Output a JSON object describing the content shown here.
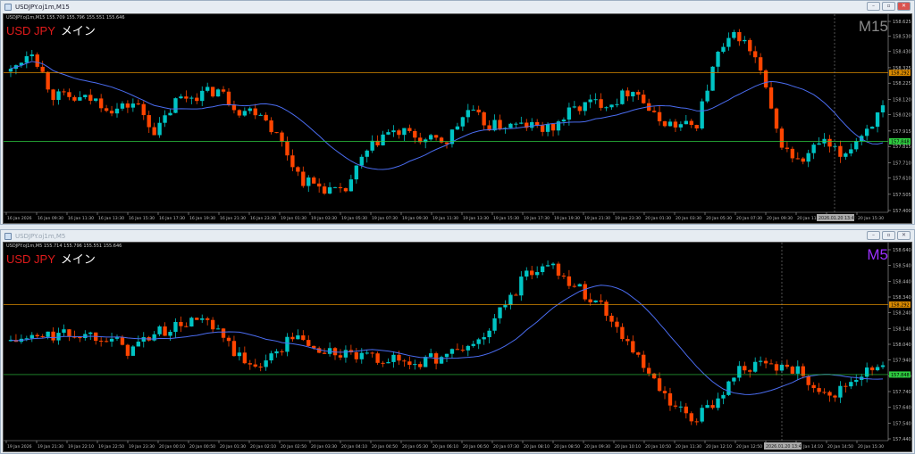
{
  "windows": [
    {
      "title": "USDJPY.oj1m,M15",
      "header": "USDJPY.oj1m,M15  155.709 155.796 155.551 155.646",
      "symbol": "USD JPY",
      "label_jp": "メイン",
      "timeframe": "M15",
      "timeframe_color": "#8a8a8a",
      "price_axis": [
        "158.625",
        "158.530",
        "158.430",
        "158.325",
        "158.225",
        "158.120",
        "158.020",
        "157.915",
        "157.815",
        "157.710",
        "157.610",
        "157.505",
        "157.400"
      ],
      "axis_min": 157.4,
      "axis_max": 158.625,
      "hline_orange": {
        "label": "158.292",
        "value": 158.292
      },
      "hline_green": {
        "label": "157.848",
        "value": 157.848
      },
      "crosshair_label": "2026.01.20 13:40",
      "time_axis": [
        "16 Jan 2026",
        "16 Jan 09:30",
        "16 Jan 11:30",
        "16 Jan 13:30",
        "16 Jan 15:30",
        "16 Jan 17:30",
        "16 Jan 19:30",
        "16 Jan 21:30",
        "16 Jan 23:30",
        "19 Jan 01:30",
        "19 Jan 03:30",
        "19 Jan 05:30",
        "19 Jan 07:30",
        "19 Jan 09:30",
        "19 Jan 11:30",
        "19 Jan 13:30",
        "19 Jan 15:30",
        "19 Jan 17:30",
        "19 Jan 19:30",
        "19 Jan 21:30",
        "19 Jan 23:30",
        "20 Jan 01:30",
        "20 Jan 03:30",
        "20 Jan 05:30",
        "20 Jan 07:30",
        "20 Jan 09:30",
        "20 Jan 11:30",
        "20 Jan 13:30",
        "20 Jan 15:30"
      ],
      "price_path": [
        158.3,
        158.45,
        158.15,
        158.12,
        158.12,
        158.05,
        158.1,
        157.9,
        158.12,
        158.15,
        158.18,
        158.05,
        158.05,
        157.85,
        157.6,
        157.55,
        157.5,
        157.75,
        157.9,
        157.9,
        157.85,
        157.85,
        158.05,
        157.95,
        157.95,
        157.95,
        157.92,
        158.05,
        158.1,
        158.1,
        158.2,
        158.0,
        157.95,
        157.95,
        158.4,
        158.55,
        158.35,
        157.85,
        157.7,
        157.85,
        157.75,
        157.9,
        158.05
      ]
    },
    {
      "title": "USDJPY.oj1m,M5",
      "header": "USDJPY.oj1m,M5  155.714 155.796 155.551 155.646",
      "symbol": "USD JPY",
      "label_jp": "メイン",
      "timeframe": "M5",
      "timeframe_color": "#9b30ff",
      "price_axis": [
        "158.640",
        "158.540",
        "158.440",
        "158.340",
        "158.240",
        "158.140",
        "158.040",
        "157.940",
        "157.840",
        "157.740",
        "157.640",
        "157.540",
        "157.440"
      ],
      "axis_min": 157.44,
      "axis_max": 158.64,
      "hline_orange": {
        "label": "158.292",
        "value": 158.292
      },
      "hline_green": {
        "label": "157.848",
        "value": 157.848
      },
      "crosshair_label": "2026.01.20 13:40",
      "time_axis": [
        "19 Jan 2026",
        "19 Jan 21:30",
        "19 Jan 22:10",
        "19 Jan 22:50",
        "19 Jan 23:30",
        "20 Jan 00:10",
        "20 Jan 00:50",
        "20 Jan 01:30",
        "20 Jan 02:10",
        "20 Jan 02:50",
        "20 Jan 03:30",
        "20 Jan 04:10",
        "20 Jan 04:50",
        "20 Jan 05:30",
        "20 Jan 06:10",
        "20 Jan 06:50",
        "20 Jan 07:30",
        "20 Jan 08:10",
        "20 Jan 08:50",
        "20 Jan 09:30",
        "20 Jan 10:10",
        "20 Jan 10:50",
        "20 Jan 11:30",
        "20 Jan 12:10",
        "20 Jan 12:50",
        "20 Jan 13:30",
        "20 Jan 14:10",
        "20 Jan 14:50",
        "20 Jan 15:30"
      ],
      "price_path": [
        158.06,
        158.08,
        158.1,
        158.1,
        158.1,
        158.0,
        158.1,
        158.15,
        158.2,
        158.08,
        157.9,
        157.95,
        158.1,
        158.0,
        157.98,
        157.95,
        157.95,
        157.92,
        157.95,
        158.0,
        158.07,
        158.3,
        158.5,
        158.55,
        158.4,
        158.3,
        158.1,
        157.85,
        157.65,
        157.55,
        157.7,
        157.9,
        157.9,
        157.9,
        157.8,
        157.72,
        157.85,
        157.88
      ]
    }
  ],
  "colors": {
    "bull": "#00c4c4",
    "bear": "#ff4500",
    "ma": "#4a6cf0",
    "orange": "#d98a00",
    "green": "#2ecc40"
  }
}
